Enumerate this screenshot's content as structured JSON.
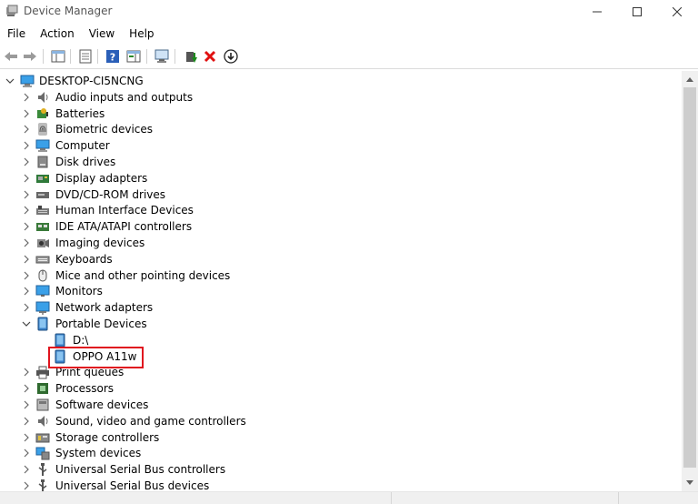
{
  "window": {
    "title": "Device Manager",
    "minimize_glyph": "—",
    "maximize_glyph": "☐",
    "close_glyph": "✕"
  },
  "menu": [
    "File",
    "Action",
    "View",
    "Help"
  ],
  "toolbar": {
    "buttons": [
      "back-arrow-icon",
      "forward-arrow-icon",
      "show-hide-console-tree-icon",
      "properties-icon",
      "help-icon",
      "action-pane-icon",
      "scan-hardware-icon",
      "update-driver-icon",
      "uninstall-device-icon",
      "disable-device-icon"
    ],
    "uninstall_color": "#e01010",
    "update_color": "#1a8a1a"
  },
  "tree": {
    "root": "DESKTOP-CI5NCNG",
    "categories": [
      {
        "label": "Audio inputs and outputs",
        "icon": "speaker-icon"
      },
      {
        "label": "Batteries",
        "icon": "battery-icon"
      },
      {
        "label": "Biometric devices",
        "icon": "fingerprint-icon"
      },
      {
        "label": "Computer",
        "icon": "computer-icon"
      },
      {
        "label": "Disk drives",
        "icon": "disk-drive-icon"
      },
      {
        "label": "Display adapters",
        "icon": "display-adapter-icon"
      },
      {
        "label": "DVD/CD-ROM drives",
        "icon": "dvd-icon"
      },
      {
        "label": "Human Interface Devices",
        "icon": "hid-icon"
      },
      {
        "label": "IDE ATA/ATAPI controllers",
        "icon": "ide-controller-icon"
      },
      {
        "label": "Imaging devices",
        "icon": "camera-icon"
      },
      {
        "label": "Keyboards",
        "icon": "keyboard-icon"
      },
      {
        "label": "Mice and other pointing devices",
        "icon": "mouse-icon"
      },
      {
        "label": "Monitors",
        "icon": "monitor-icon"
      },
      {
        "label": "Network adapters",
        "icon": "network-adapter-icon"
      },
      {
        "label": "Portable Devices",
        "icon": "portable-device-icon",
        "expanded": true,
        "children": [
          {
            "label": "D:\\",
            "icon": "portable-device-icon"
          },
          {
            "label": "OPPO A11w",
            "icon": "portable-device-icon",
            "highlighted": true
          }
        ]
      },
      {
        "label": "Print queues",
        "icon": "printer-icon"
      },
      {
        "label": "Processors",
        "icon": "processor-icon"
      },
      {
        "label": "Software devices",
        "icon": "software-device-icon"
      },
      {
        "label": "Sound, video and game controllers",
        "icon": "speaker-icon"
      },
      {
        "label": "Storage controllers",
        "icon": "storage-controller-icon"
      },
      {
        "label": "System devices",
        "icon": "system-devices-icon"
      },
      {
        "label": "Universal Serial Bus controllers",
        "icon": "usb-icon"
      },
      {
        "label": "Universal Serial Bus devices",
        "icon": "usb-icon"
      }
    ]
  },
  "highlight_color": "#e0141e"
}
